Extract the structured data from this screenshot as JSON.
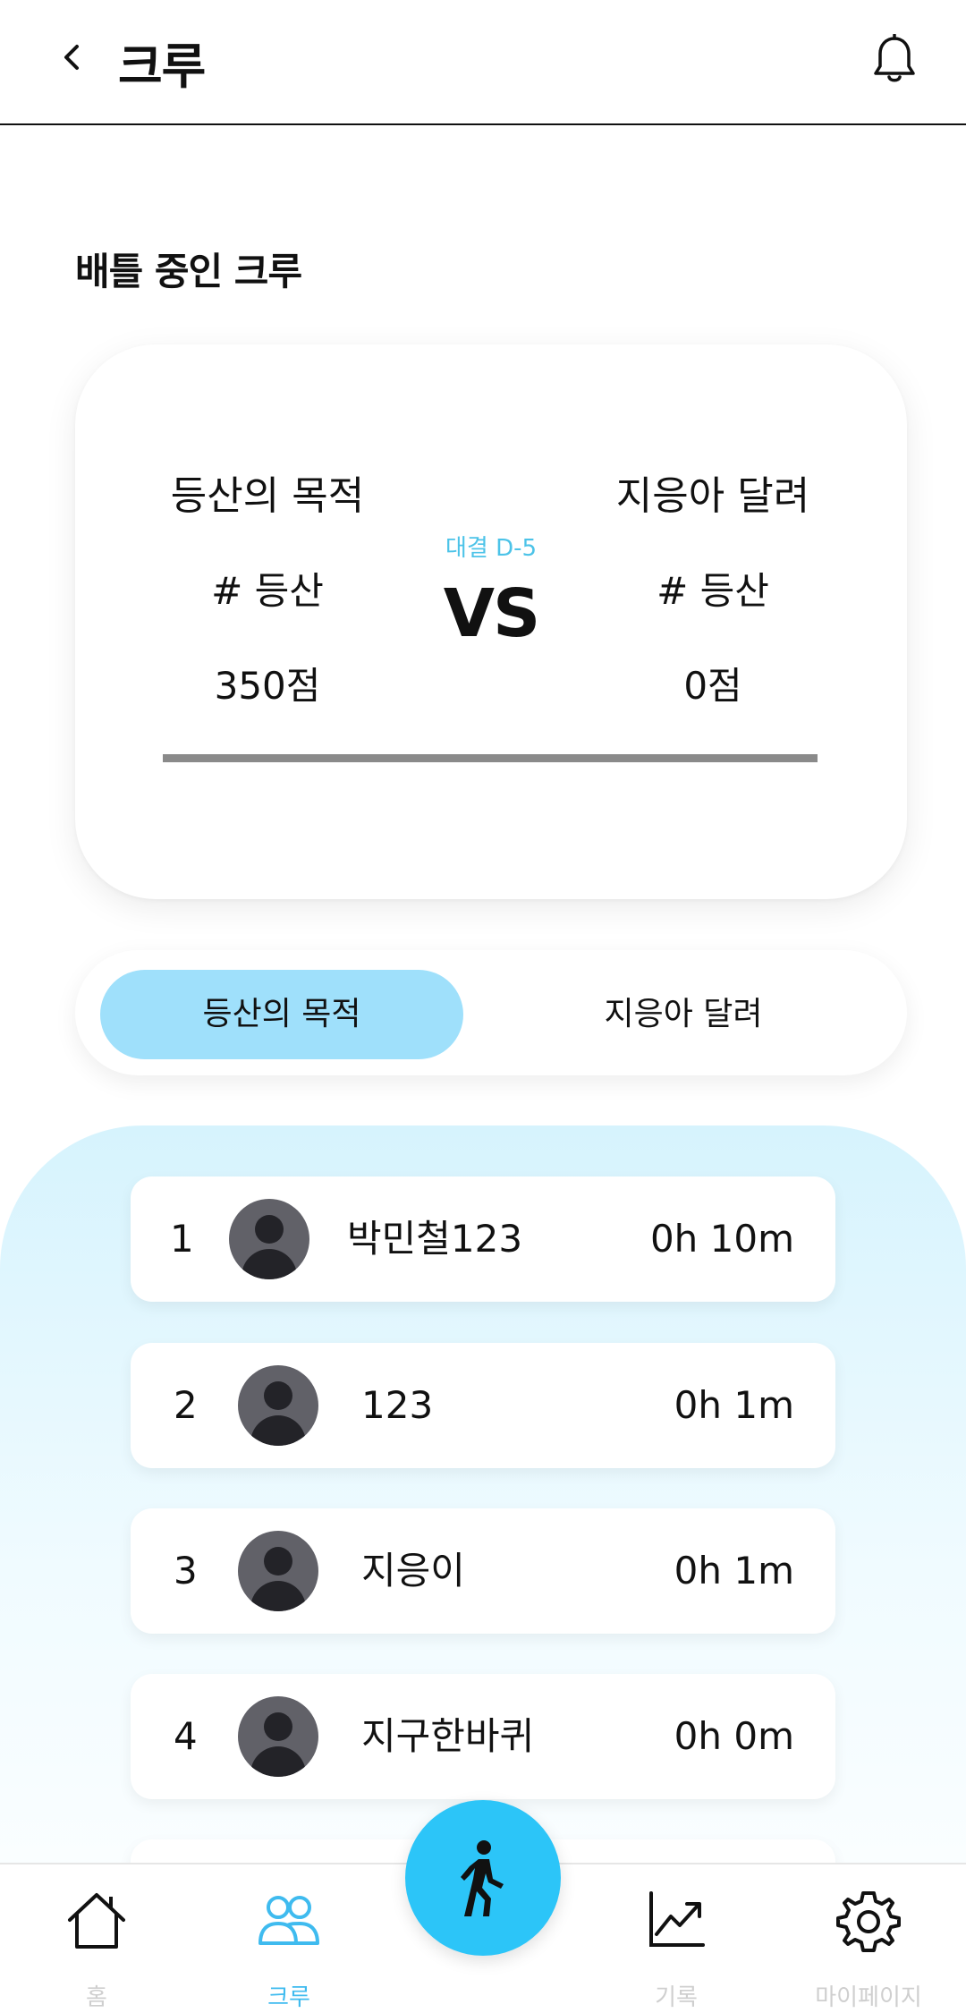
{
  "header": {
    "title": "크루"
  },
  "section": {
    "title": "배틀 중인 크루"
  },
  "battle": {
    "left": {
      "name": "등산의 목적",
      "tag": "# 등산",
      "score": "350점"
    },
    "right": {
      "name": "지응아 달려",
      "tag": "# 등산",
      "score": "0점"
    },
    "dday": "대결 D-5",
    "vs": "VS",
    "progress_left_fraction": 1.0
  },
  "toggle": {
    "active": "등산의 목적",
    "inactive": "지응아 달려"
  },
  "ranking": [
    {
      "rank": "1",
      "name": "박민철123",
      "time": "0h 10m"
    },
    {
      "rank": "2",
      "name": "123",
      "time": "0h 1m"
    },
    {
      "rank": "3",
      "name": "지응이",
      "time": "0h 1m"
    },
    {
      "rank": "4",
      "name": "지구한바퀴",
      "time": "0h 0m"
    }
  ],
  "nav": {
    "home": "홈",
    "crew": "크루",
    "records": "기록",
    "mypage": "마이페이지",
    "active": "crew"
  },
  "colors": {
    "accent": "#2cc5f8",
    "toggle_active": "#9fe0fb",
    "dday": "#4cc3e8",
    "nav_active": "#3fbbef"
  }
}
